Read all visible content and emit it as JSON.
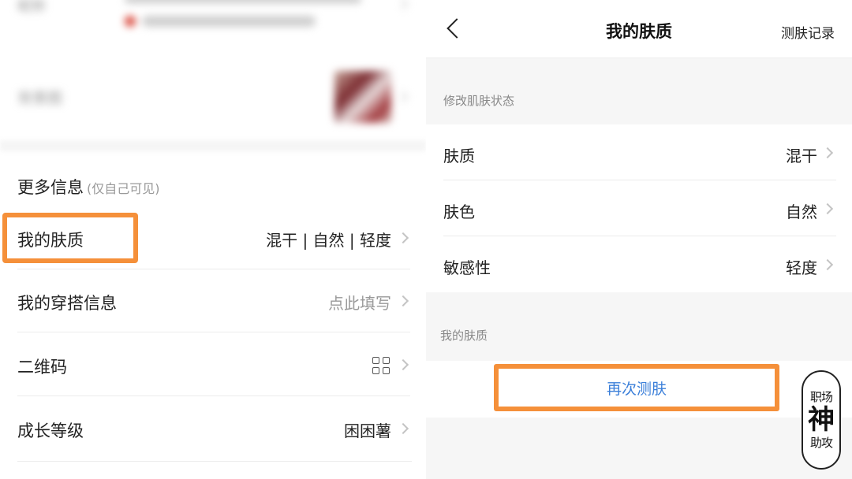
{
  "left": {
    "top_row_label": "昵称",
    "background_label": "背景图",
    "section_title": "更多信息",
    "section_note": "(仅自己可见)",
    "rows": [
      {
        "label": "我的肤质",
        "value": "混干 | 自然 | 轻度"
      },
      {
        "label": "我的穿搭信息",
        "value": "点此填写"
      },
      {
        "label": "二维码",
        "value": ""
      },
      {
        "label": "成长等级",
        "value": "困困薯"
      }
    ]
  },
  "right": {
    "nav": {
      "title": "我的肤质",
      "record": "测肤记录"
    },
    "modify_label": "修改肌肤状态",
    "rows": [
      {
        "label": "肤质",
        "value": "混干"
      },
      {
        "label": "肤色",
        "value": "自然"
      },
      {
        "label": "敏感性",
        "value": "轻度"
      }
    ],
    "section2_label": "我的肤质",
    "retest_label": "再次测肤"
  },
  "watermark": {
    "top": "职场",
    "middle": "神",
    "bottom": "助攻"
  },
  "colors": {
    "highlight": "#f5903a",
    "link_blue": "#3b7fd9",
    "text_muted": "#999999"
  },
  "icons": [
    "back-chevron-icon",
    "chevron-right-icon",
    "qr-code-icon"
  ]
}
